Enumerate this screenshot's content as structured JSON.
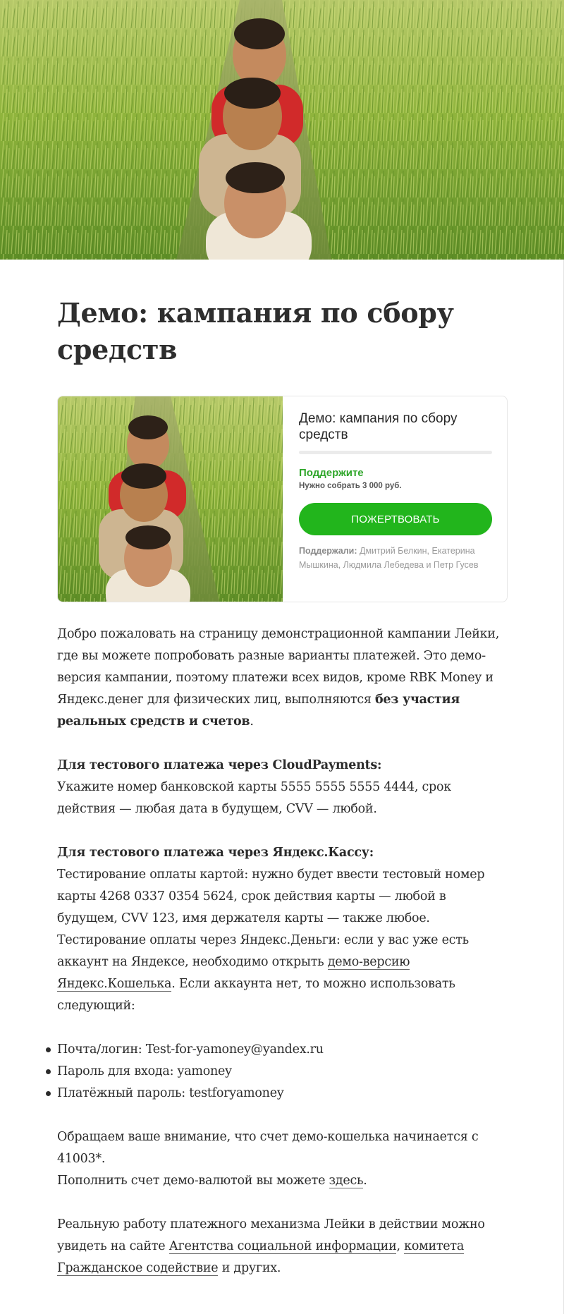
{
  "page": {
    "title": "Демо: кампания по сбору средств",
    "hero_image": "children-in-rice-field-photo"
  },
  "campaign_card": {
    "title": "Демо: кампания по сбору средств",
    "progress_fraction": 0.0,
    "support_label": "Поддержите",
    "target_text": "Нужно собрать 3 000  руб.",
    "donate_label": "Пожертвовать",
    "supporters_label": "Поддержали:",
    "supporters_names": "Дмитрий Белкин, Екатерина Мышкина, Людмила Лебедева и Петр Гусев",
    "accent_color": "#22b51c"
  },
  "content": {
    "intro_part1": "Добро пожаловать на страницу демонстрационной кампании Лейки, где вы можете попробовать разные варианты платежей. Это демо-версия кампании, поэтому платежи всех видов, кроме RBK Money и Яндекс.денег для физических лиц, выполняются ",
    "intro_bold": "без участия реальных средств и счетов",
    "intro_end": ".",
    "cloud_heading": "Для тестового платежа через CloudPayments:",
    "cloud_text": "Укажите номер банковской карты 5555 5555 5555 4444, срок действия — любая дата в будущем, CVV — любой.",
    "yandex_heading": "Для тестового платежа через Яндекс.Кассу:",
    "yandex_card_text": "Тестирование оплаты картой: нужно будет ввести тестовый номер карты 4268 0337 0354 5624, срок действия карты — любой в будущем, CVV 123, имя держателя карты — также любое.",
    "yandex_money_text1": "Тестирование оплаты через Яндекс.Деньги: если у вас уже есть аккаунт на Яндексе, необходимо открыть ",
    "yandex_money_link": "демо-версию Яндекс.Кошелька",
    "yandex_money_text2": ". Если аккаунта нет, то можно использовать следующий:",
    "credentials": [
      "Почта/логин: Test-for-yamoney@yandex.ru",
      "Пароль для входа: yamoney",
      "Платёжный пароль: testforyamoney"
    ],
    "notice_text": "Обращаем ваше внимание, что счет демо-кошелька начинается с 41003*.",
    "topup_text": "Пополнить счет демо-валютой вы можете ",
    "topup_link": "здесь",
    "topup_end": ".",
    "real_text1": "Реальную работу платежного механизма Лейки в действии можно увидеть на сайте ",
    "real_link1": "Агентства социальной информации",
    "real_sep": ", ",
    "real_link2": "комитета Гражданское содействие",
    "real_end": " и других."
  }
}
